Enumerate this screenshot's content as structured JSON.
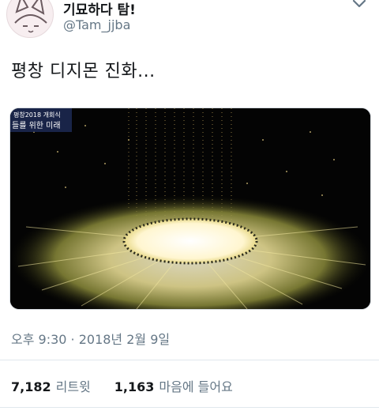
{
  "author": {
    "display_name": "기묘하다 탐!",
    "handle": "@Tam_jjba",
    "avatar_icon": "cartoon-cat-avatar-icon"
  },
  "menu": {
    "icon": "chevron-down-icon"
  },
  "tweet": {
    "text": "평창 디지몬 진화..."
  },
  "media": {
    "broadcast_caption_top": "평창2018 개회식",
    "broadcast_caption_bottom": "들를 위한 미래"
  },
  "meta": {
    "timestamp": "오후 9:30 · 2018년 2월 9일"
  },
  "stats": {
    "retweets_count": "7,182",
    "retweets_label": "리트윗",
    "likes_count": "1,163",
    "likes_label": "마음에 들어요"
  },
  "colors": {
    "text_primary": "#14171a",
    "text_secondary": "#657786",
    "divider": "#e1e8ed",
    "light_gold": "#f5e9a8"
  }
}
